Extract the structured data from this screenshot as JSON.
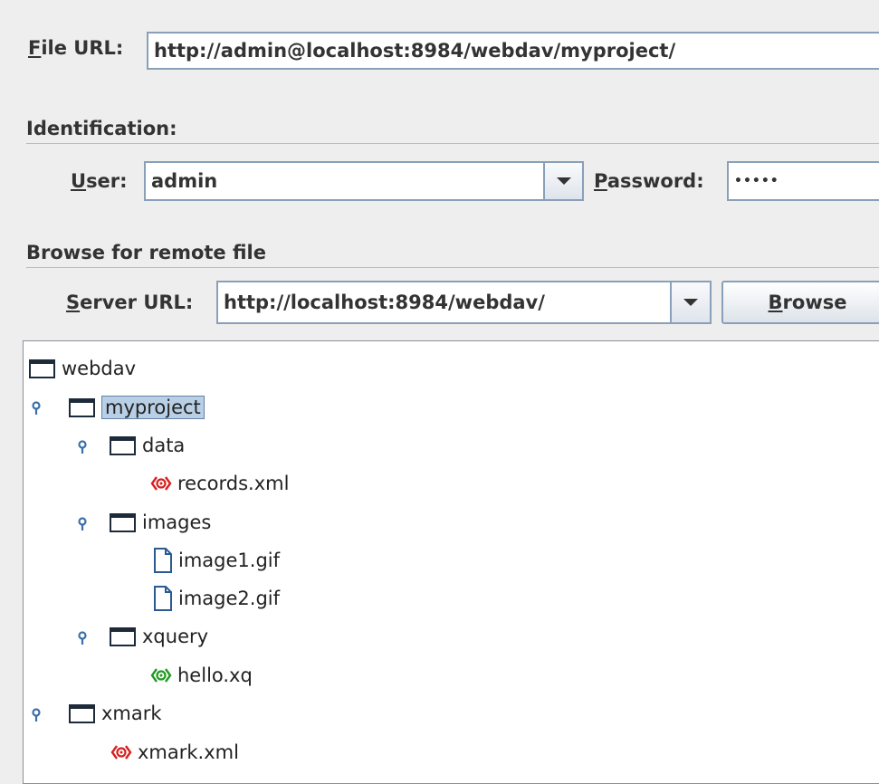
{
  "file_url": {
    "label": "File URL:",
    "mnemonic": "F",
    "rest": "ile URL:",
    "value": "http://admin@localhost:8984/webdav/myproject/"
  },
  "identification": {
    "title": "Identification:",
    "user_mnemonic": "U",
    "user_rest": "ser:",
    "user_value": "admin",
    "password_mnemonic": "P",
    "password_rest": "assword:",
    "password_value": "•••••"
  },
  "browse": {
    "title": "Browse for remote file",
    "server_mnemonic": "S",
    "server_rest": "erver URL:",
    "server_value": "http://localhost:8984/webdav/",
    "button_mnemonic": "B",
    "button_rest": "rowse"
  },
  "tree": {
    "nodes": [
      {
        "label": "webdav",
        "icon": "folder-icon"
      },
      {
        "label": "myproject",
        "icon": "folder-icon",
        "expanded": true,
        "selected": true
      },
      {
        "label": "data",
        "icon": "folder-icon",
        "expanded": true
      },
      {
        "label": "records.xml",
        "icon": "xml-file-icon"
      },
      {
        "label": "images",
        "icon": "folder-icon",
        "expanded": true
      },
      {
        "label": "image1.gif",
        "icon": "file-icon"
      },
      {
        "label": "image2.gif",
        "icon": "file-icon"
      },
      {
        "label": "xquery",
        "icon": "folder-icon",
        "expanded": true
      },
      {
        "label": "hello.xq",
        "icon": "xquery-file-icon"
      },
      {
        "label": "xmark",
        "icon": "folder-icon",
        "expanded": true
      },
      {
        "label": "xmark.xml",
        "icon": "xml-file-icon"
      }
    ]
  },
  "colors": {
    "xml_icon": "#d81f1f",
    "xquery_icon": "#1f9a1f",
    "handle": "#3b6fa8",
    "selection": "#b8cfe5"
  }
}
